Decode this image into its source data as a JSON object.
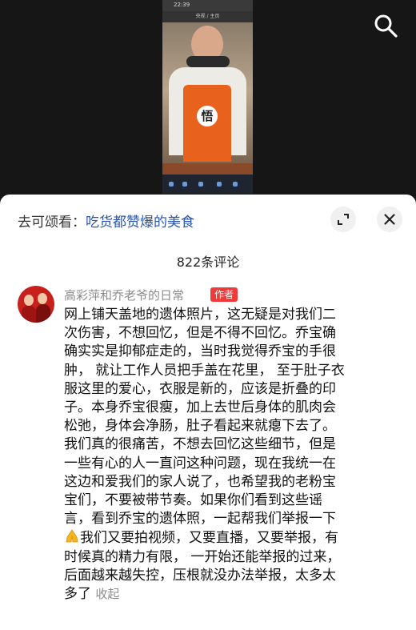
{
  "video": {
    "phone_time": "22:39",
    "phone_title": "央视 / 主页",
    "apron_char": "悟"
  },
  "sheet": {
    "watch_prefix": "去可颂看：",
    "watch_link": "吃货都赞爆的美食",
    "comment_count": "822条评论"
  },
  "comment": {
    "author": "高彩萍和乔老爷的日常",
    "badge": "作者",
    "lines": [
      "网上铺天盖地的遗体照片，这无疑是对我们二",
      "次伤害，不想回忆，但是不得不回忆。乔宝确",
      "确实实是抑郁症走的，当时我觉得乔宝的手很",
      "肿， 就让工作人员把手盖在花里， 至于肚子衣",
      "服这里的爱心，衣服是新的，应该是折叠的印",
      "子。本身乔宝很瘦，加上去世后身体的肌肉会",
      "松弛，身体会净肠，肚子看起来就瘪下去了。",
      "我们真的很痛苦，不想去回忆这些细节，但是",
      "一些有心的人一直问这种问题，现在我统一在",
      "这边和爱我们的家人说了，也希望我的老粉宝",
      "宝们，不要被带节奏。如果你们看到这些谣",
      "言，看到乔宝的遗体照，一起帮我们举报一下",
      "我们又要拍视频，又要直播，又要举报，有",
      "时候真的精力有限， 一开始还能举报的过来，",
      "后面越来越失控，压根就没办法举报，太多太",
      "多了"
    ],
    "fold_label": "收起",
    "pray_icon": "pray-hands-emoji"
  },
  "colors": {
    "link": "#2a55a8",
    "badge": "#f03a3a",
    "muted": "#8c8c8c"
  }
}
